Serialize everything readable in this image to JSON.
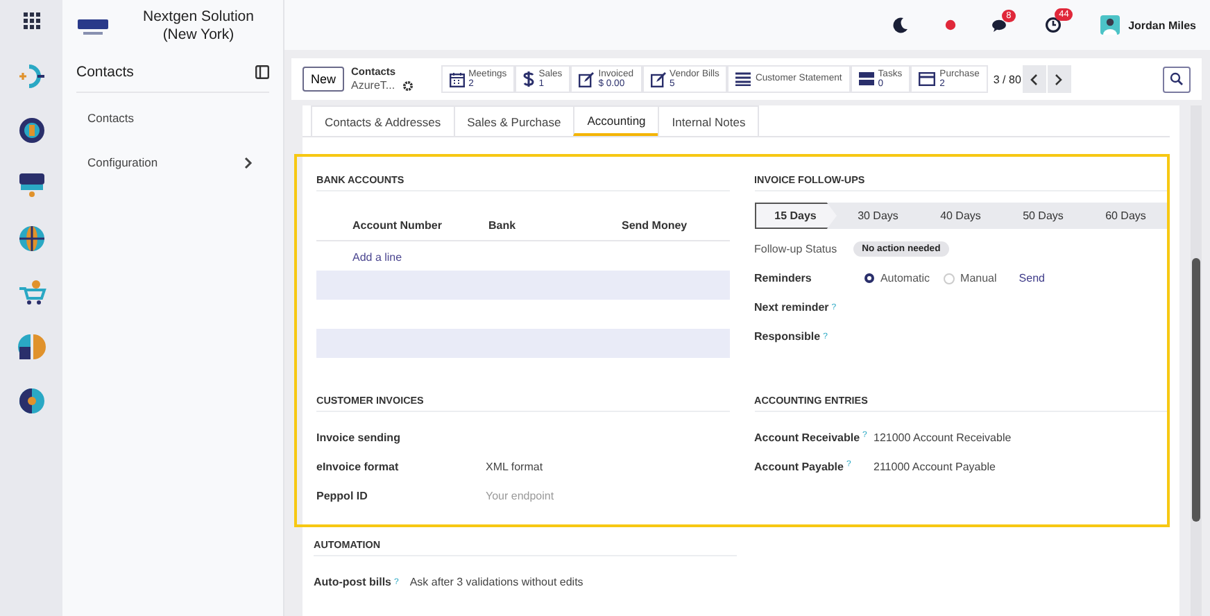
{
  "sidebar": {
    "company": "Nextgen Solution (New York)",
    "title": "Contacts",
    "items": [
      {
        "label": "Contacts",
        "has_children": false
      },
      {
        "label": "Configuration",
        "has_children": true
      }
    ]
  },
  "topbar": {
    "messages_badge": "8",
    "activity_badge": "44",
    "user": "Jordan Miles"
  },
  "control_panel": {
    "new_button": "New",
    "breadcrumb": "Contacts",
    "record": "AzureT...",
    "stats": [
      {
        "kind": "calendar",
        "label": "Meetings",
        "value": "2"
      },
      {
        "kind": "dollar",
        "label": "Sales",
        "value": "1"
      },
      {
        "kind": "edit",
        "label": "Invoiced",
        "value": "$ 0.00"
      },
      {
        "kind": "edit",
        "label": "Vendor Bills",
        "value": "5"
      },
      {
        "kind": "list",
        "label": "Customer Statement"
      },
      {
        "kind": "tasks",
        "label": "Tasks",
        "value": "0"
      },
      {
        "kind": "card",
        "label": "Purchase",
        "value": "2"
      }
    ],
    "pager": "3 / 80"
  },
  "tabs": [
    {
      "label": "Contacts & Addresses",
      "selected": false
    },
    {
      "label": "Sales & Purchase",
      "selected": false
    },
    {
      "label": "Accounting",
      "selected": true
    },
    {
      "label": "Internal Notes",
      "selected": false
    }
  ],
  "bank_accounts": {
    "title": "BANK ACCOUNTS",
    "columns": [
      "Account Number",
      "Bank",
      "Send Money"
    ],
    "add_line": "Add a line"
  },
  "invoice_follow_ups": {
    "title": "INVOICE FOLLOW-UPS",
    "steps": [
      {
        "label": "15 Days",
        "selected": true
      },
      {
        "label": "30 Days",
        "selected": false
      },
      {
        "label": "40 Days",
        "selected": false
      },
      {
        "label": "50 Days",
        "selected": false
      },
      {
        "label": "60 Days",
        "selected": false
      }
    ],
    "status_label": "Follow-up Status",
    "status": "No action needed",
    "reminders_label": "Reminders",
    "reminder_options": [
      {
        "label": "Automatic",
        "selected": true
      },
      {
        "label": "Manual",
        "selected": false
      }
    ],
    "send": "Send",
    "fields": [
      {
        "label": "Next reminder",
        "help": "?"
      },
      {
        "label": "Responsible",
        "help": "?"
      }
    ]
  },
  "customer_invoices": {
    "title": "CUSTOMER INVOICES",
    "fields": [
      {
        "label": "Invoice sending"
      },
      {
        "label": "eInvoice format",
        "value": "XML format"
      },
      {
        "label": "Peppol ID",
        "placeholder": "Your endpoint"
      }
    ]
  },
  "accounting_entries": {
    "title": "ACCOUNTING ENTRIES",
    "fields": [
      {
        "label": "Account Receivable",
        "help": "?",
        "value": "121000 Account Receivable"
      },
      {
        "label": "Account Payable",
        "help": "?",
        "value": "211000 Account Payable"
      }
    ]
  },
  "automation": {
    "title": "AUTOMATION",
    "fields": [
      {
        "label": "Auto-post bills",
        "help": "?",
        "value": "Ask after 3 validations without edits"
      }
    ]
  }
}
